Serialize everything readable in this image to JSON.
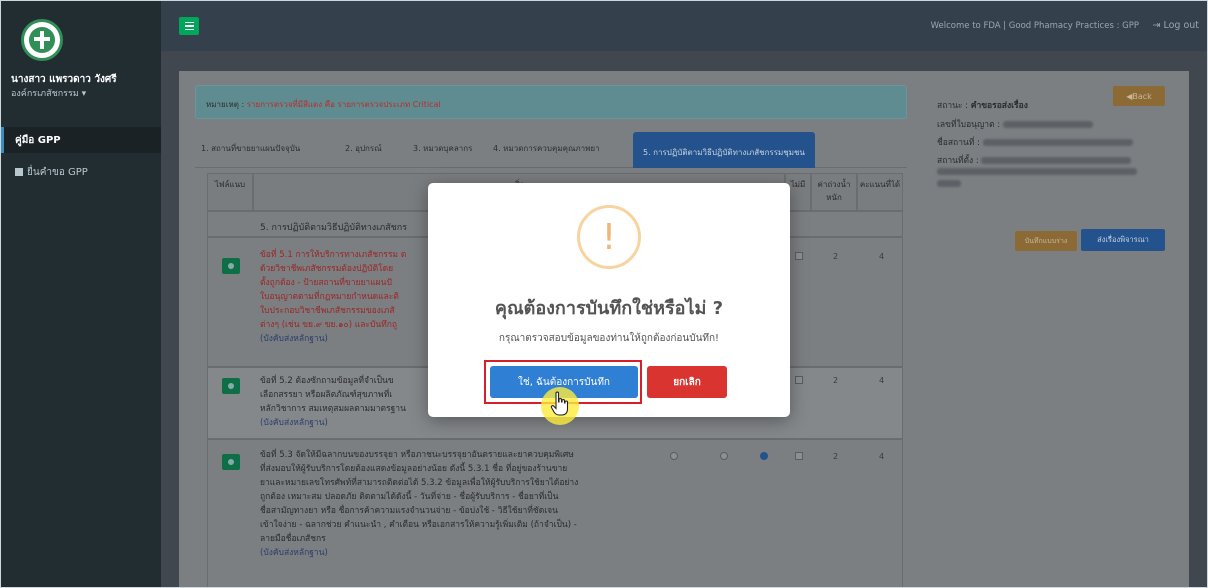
{
  "sidebar": {
    "user_name": "นางสาว แพรวดาว วังศรี",
    "user_org": "องค์กรเภสัชกรรม ▾",
    "items": [
      {
        "label": "คู่มือ GPP"
      },
      {
        "label": "ยื่นคำขอ GPP"
      }
    ]
  },
  "topbar": {
    "welcome": "Welcome to FDA | Good Phamacy Practices : GPP",
    "logout": "Log out"
  },
  "alert": {
    "label": "หมายเหตุ :",
    "text": "รายการตรวจที่มีสีแดง คือ รายการตรวจประเภท Critical"
  },
  "tabs": [
    {
      "label": "1. สถานที่ขายยาแผนปัจจุบัน"
    },
    {
      "label": "2. อุปกรณ์"
    },
    {
      "label": "3. หมวดบุคลากร"
    },
    {
      "label": "4. หมวดการควบคุมคุณภาพยา"
    },
    {
      "label": "5. การปฏิบัติตามวิธีปฏิบัติทางเภสัชกรรมชุมชน"
    }
  ],
  "table": {
    "headers": {
      "file": "ไฟล์แนบ",
      "item": "สิ่ง",
      "na": "ไม่มี",
      "weight": "ค่าถ่วงน้ำหนัก",
      "score": "คะแนนที่ได้"
    },
    "section_title": "5. การปฏิบัติตามวิธีปฏิบัติทางเภสัชกร",
    "rows": [
      {
        "lines": [
          "ข้อที่ 5.1 การให้บริการทางเภสัชกรรม ต",
          "ด้วยวิชาชีพเภสัชกรรมต้องปฏิบัติโดย",
          "ตั้งถูกต้อง - ป้ายสถานที่ขายยาแผนปั",
          "ใบอนุญาตตามที่กฎหมายกำหนดและติ",
          "ใบประกอบวิชาชีพเภสัชกรรมของเภสั",
          "ต่างๆ (เช่น ขย.๙ ขย.๑๐) และบันทึกถู"
        ],
        "req": "(บังคับส่งหลักฐาน)",
        "weight": "2",
        "score": "4"
      },
      {
        "lines": [
          "ข้อที่ 5.2 ต้องซักถามข้อมูลที่จำเป็นข",
          "เลือกสรรยา หรือผลิตภัณฑ์สุขภาพที่เ",
          "หลักวิชาการ สมเหตุสมผลตามมาตรฐาน"
        ],
        "req": "(บังคับส่งหลักฐาน)",
        "weight": "2",
        "score": "4"
      },
      {
        "lines": [
          "ข้อที่ 5.3 จัดให้มีฉลากบนของบรรจุยา หรือภาชนะบรรจุยาอันตรายและยาควบคุมพิเศษ",
          "ที่ส่งมอบให้ผู้รับบริการโดยต้องแสดงข้อมูลอย่างน้อย ดังนี้ 5.3.1 ชื่อ ที่อยู่ของร้านขาย",
          "ยาและหมายเลขโทรศัพท์ที่สามารถติดต่อได้ 5.3.2 ข้อมูลเพื่อให้ผู้รับบริการใช้ยาได้อย่าง",
          "ถูกต้อง เหมาะสม ปลอดภัย ติดตามได้ดังนี้ - วันที่จ่าย - ชื่อผู้รับบริการ - ชื่อยาที่เป็น",
          "ชื่อสามัญทางยา หรือ ชื่อการค้าความแรงจำนวนจ่าย - ข้อบ่งใช้ - วิธีใช้ยาที่ชัดเจน",
          "เข้าใจง่าย - ฉลากช่วย คำแนะนำ , คำเตือน หรือเอกสารให้ความรู้เพิ่มเติม (ถ้าจำเป็น) -",
          "ลายมือชื่อเภสัชกร"
        ],
        "req": "(บังคับส่งหลักฐาน)",
        "weight": "2",
        "score": "4"
      }
    ]
  },
  "panel": {
    "status_label": "สถานะ :",
    "status_value": "คำขอรอส่งเรื่อง",
    "license_label": "เลขที่ใบอนุญาต :",
    "name_label": "ชื่อสถานที่ :",
    "address_label": "สถานที่ตั้ง :",
    "back": "Back",
    "save_draft": "บันทึกแบบร่าง",
    "submit": "ส่งเรื่องพิจารณา"
  },
  "modal": {
    "icon": "!",
    "title": "คุณต้องการบันทึกใช่หรือไม่ ?",
    "text": "กรุณาตรวจสอบข้อมูลของท่านให้ถูกต้องก่อนบันทึก!",
    "confirm": "ใช่, ฉันต้องการบันทึก",
    "cancel": "ยกเลิก"
  },
  "colors": {
    "confirm": "#2f7fd4",
    "cancel": "#d9342f",
    "highlight_outline": "#d61f2a",
    "warning": "#f0b67a"
  }
}
